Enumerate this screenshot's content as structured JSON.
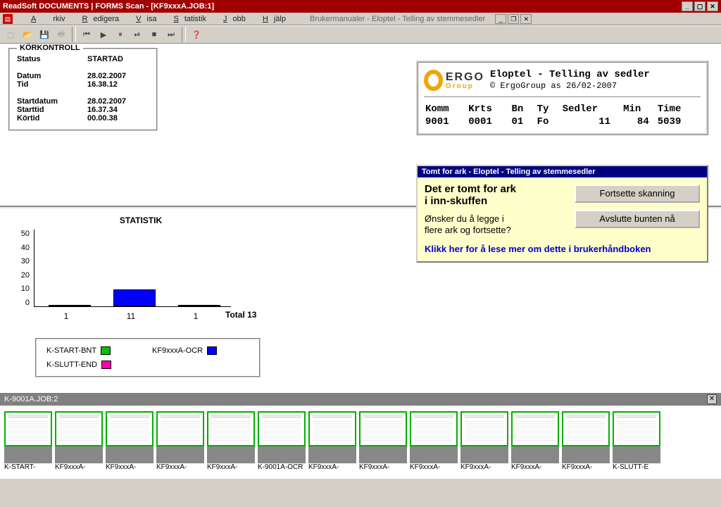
{
  "window": {
    "title": "ReadSoft DOCUMENTS | FORMS Scan - [KF9xxxA.JOB:1]"
  },
  "menu": {
    "arkiv": "Arkiv",
    "redigera": "Redigera",
    "visa": "Visa",
    "statistik": "Statistik",
    "jobb": "Jobb",
    "hjalp": "Hjälp",
    "brukermanualer": "Brukermanualer - Eloptel - Telling av stemmesedler"
  },
  "korkontroll": {
    "title": "KÖRKONTROLL",
    "status_l": "Status",
    "status_v": "STARTAD",
    "datum_l": "Datum",
    "datum_v": "28.02.2007",
    "tid_l": "Tid",
    "tid_v": "16.38.12",
    "startdatum_l": "Startdatum",
    "startdatum_v": "28.02.2007",
    "starttid_l": "Starttid",
    "starttid_v": "16.37.34",
    "kortid_l": "Körtid",
    "kortid_v": "00.00.38"
  },
  "info": {
    "logo1": "ERGO",
    "logo2": "Group",
    "heading": "Eloptel - Telling av sedler",
    "sub": "© ErgoGroup as     26/02-2007",
    "h_komm": "Komm",
    "h_krts": "Krts",
    "h_bn": "Bn",
    "h_ty": "Ty",
    "h_sedler": "Sedler",
    "h_min": "Min",
    "h_time": "Time",
    "v_komm": "9001",
    "v_krts": "0001",
    "v_bn": "01",
    "v_ty": "Fo",
    "v_sedler": "11",
    "v_min": "84",
    "v_time": "5039"
  },
  "dialog": {
    "title": "Tomt for ark - Eloptel - Telling av stemmesedler",
    "heading_l1": "Det er tomt for ark",
    "heading_l2": "i inn-skuffen",
    "text_l1": "Ønsker du å legge i",
    "text_l2": "flere ark og fortsette?",
    "btn1": "Fortsette skanning",
    "btn2": "Avslutte bunten nå",
    "link": "Klikk her for å lese mer om dette i brukerhåndboken"
  },
  "stats": {
    "title": "STATISTIK",
    "total_label": "Total 13",
    "y0": "0",
    "y10": "10",
    "y20": "20",
    "y30": "30",
    "y40": "40",
    "y50": "50",
    "x1": "1",
    "x2": "11",
    "x3": "1",
    "leg1": "K-START-BNT",
    "leg2": "KF9xxxA-OCR",
    "leg3": "K-SLUTT-END"
  },
  "chart_data": {
    "type": "bar",
    "categories": [
      "K-START-BNT",
      "KF9xxxA-OCR",
      "K-SLUTT-END"
    ],
    "values": [
      1,
      11,
      1
    ],
    "total": 13,
    "title": "STATISTIK",
    "ylim": [
      0,
      50
    ]
  },
  "jobbar": {
    "title": "K-9001A.JOB:2"
  },
  "thumbs": [
    {
      "label": "K-START-"
    },
    {
      "label": "KF9xxxA-"
    },
    {
      "label": "KF9xxxA-"
    },
    {
      "label": "KF9xxxA-"
    },
    {
      "label": "KF9xxxA-"
    },
    {
      "label": "K-9001A-OCR"
    },
    {
      "label": "KF9xxxA-"
    },
    {
      "label": "KF9xxxA-"
    },
    {
      "label": "KF9xxxA-"
    },
    {
      "label": "KF9xxxA-"
    },
    {
      "label": "KF9xxxA-"
    },
    {
      "label": "KF9xxxA-"
    },
    {
      "label": "K-SLUTT-E"
    }
  ]
}
